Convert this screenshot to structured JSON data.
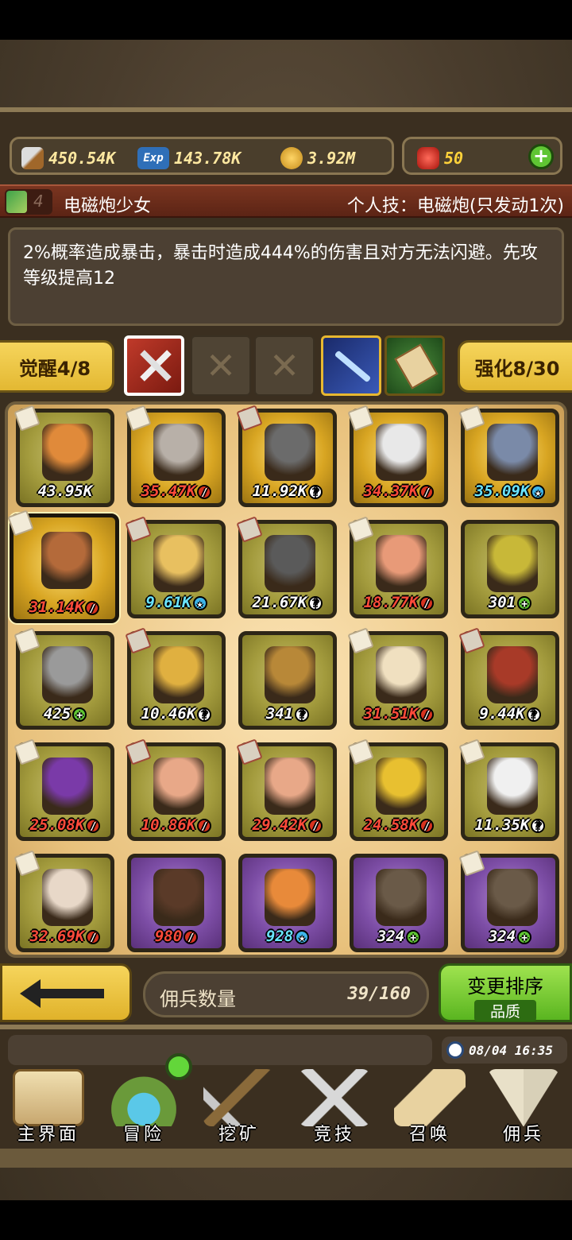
{
  "resources": {
    "attack": "450.54K",
    "exp": "143.78K",
    "gold": "3.92M",
    "gems": "50"
  },
  "hero": {
    "level": "4",
    "name": "电磁炮少女",
    "skill": "个人技：电磁炮(只发动1次)",
    "description": "2%概率造成暴击，暴击时造成444%的伤害且对方无法闪避。先攻等级提高12"
  },
  "upgrade": {
    "awaken": "觉醒4/8",
    "enhance": "强化8/30"
  },
  "grid": [
    {
      "power": "43.95K",
      "color": "white",
      "badge": "",
      "frame": "olive",
      "flag": "paper",
      "hero_color": "#e08a3a"
    },
    {
      "power": "35.47K",
      "color": "red",
      "badge": "r",
      "frame": "gold",
      "flag": "paper",
      "hero_color": "#b8b0a8"
    },
    {
      "power": "11.92K",
      "color": "white",
      "badge": "w",
      "frame": "gold",
      "flag": "sword",
      "hero_color": "#6b6b6b"
    },
    {
      "power": "34.37K",
      "color": "red",
      "badge": "r",
      "frame": "gold",
      "flag": "paper",
      "hero_color": "#e8e8e8"
    },
    {
      "power": "35.09K",
      "color": "cyan",
      "badge": "b",
      "frame": "gold",
      "flag": "paper",
      "hero_color": "#7a8aa8"
    },
    {
      "power": "31.14K",
      "color": "red",
      "badge": "r",
      "frame": "gold",
      "flag": "paper",
      "hero_color": "#b46a3a",
      "selected": true
    },
    {
      "power": "9.61K",
      "color": "cyan",
      "badge": "b",
      "frame": "olive",
      "flag": "sword",
      "hero_color": "#e8c060"
    },
    {
      "power": "21.67K",
      "color": "white",
      "badge": "w",
      "frame": "olive",
      "flag": "sword",
      "hero_color": "#5a5a5a"
    },
    {
      "power": "18.77K",
      "color": "red",
      "badge": "r",
      "frame": "olive",
      "flag": "paper",
      "hero_color": "#e89a78"
    },
    {
      "power": "301",
      "color": "white",
      "badge": "g",
      "frame": "olive",
      "flag": "",
      "hero_color": "#c8b838"
    },
    {
      "power": "425",
      "color": "white",
      "badge": "g",
      "frame": "olive",
      "flag": "paper",
      "hero_color": "#9a9a9a"
    },
    {
      "power": "10.46K",
      "color": "white",
      "badge": "w",
      "frame": "olive",
      "flag": "sword",
      "hero_color": "#e0b040"
    },
    {
      "power": "341",
      "color": "white",
      "badge": "w",
      "frame": "olive",
      "flag": "",
      "hero_color": "#b88838"
    },
    {
      "power": "31.51K",
      "color": "red",
      "badge": "r",
      "frame": "olive",
      "flag": "paper",
      "hero_color": "#f0e0c0"
    },
    {
      "power": "9.44K",
      "color": "white",
      "badge": "w",
      "frame": "olive",
      "flag": "sword",
      "hero_color": "#a83a28"
    },
    {
      "power": "25.08K",
      "color": "red",
      "badge": "r",
      "frame": "olive",
      "flag": "paper",
      "hero_color": "#7a3aa8"
    },
    {
      "power": "10.86K",
      "color": "red",
      "badge": "r",
      "frame": "olive",
      "flag": "sword",
      "hero_color": "#e8a888"
    },
    {
      "power": "29.42K",
      "color": "red",
      "badge": "r",
      "frame": "olive",
      "flag": "sword",
      "hero_color": "#e8a888"
    },
    {
      "power": "24.58K",
      "color": "red",
      "badge": "r",
      "frame": "olive",
      "flag": "paper",
      "hero_color": "#e8c030"
    },
    {
      "power": "11.35K",
      "color": "white",
      "badge": "w",
      "frame": "olive",
      "flag": "paper",
      "hero_color": "#f0f0f0"
    },
    {
      "power": "32.69K",
      "color": "red",
      "badge": "r",
      "frame": "olive",
      "flag": "paper",
      "hero_color": "#e8d8c8"
    },
    {
      "power": "980",
      "color": "red",
      "badge": "r",
      "frame": "purple",
      "flag": "",
      "hero_color": "#5a3a28"
    },
    {
      "power": "928",
      "color": "cyan",
      "badge": "b",
      "frame": "purple",
      "flag": "",
      "hero_color": "#e88a3a"
    },
    {
      "power": "324",
      "color": "white",
      "badge": "g",
      "frame": "purple",
      "flag": "",
      "hero_color": "#6a5a48"
    },
    {
      "power": "324",
      "color": "white",
      "badge": "g",
      "frame": "purple",
      "flag": "paper",
      "hero_color": "#6a5a48"
    }
  ],
  "footer": {
    "count_label": "佣兵数量",
    "count_value": "39/160",
    "sort_label": "变更排序",
    "sort_mode": "品质"
  },
  "clock": "08/04 16:35",
  "nav": [
    "主界面",
    "冒险",
    "挖矿",
    "竞技",
    "召唤",
    "佣兵"
  ],
  "colors": {
    "gold_button": "#f6d55c",
    "green_button": "#5ab520",
    "banner": "#7a3520",
    "rare_frame": "#7d4ea6"
  }
}
